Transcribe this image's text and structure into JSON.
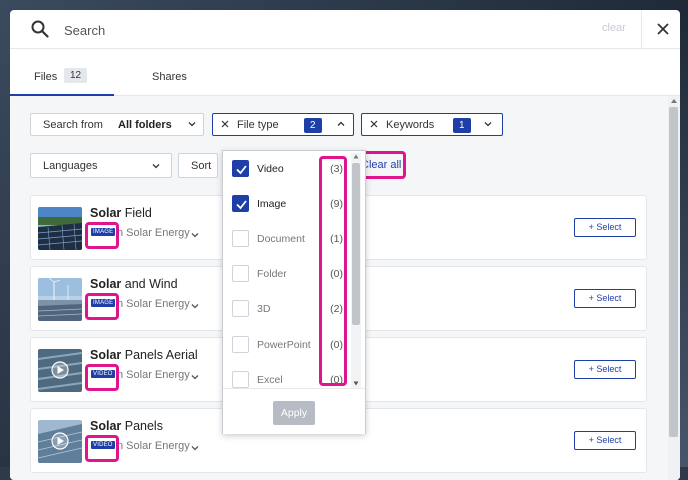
{
  "search": {
    "placeholder": "Search",
    "clear_label": "clear"
  },
  "tabs": [
    {
      "label": "Files",
      "count": "12"
    },
    {
      "label": "Shares"
    }
  ],
  "filters": {
    "search_from": {
      "label": "Search from",
      "value": "All folders"
    },
    "file_type": {
      "label": "File type",
      "count": "2"
    },
    "keywords": {
      "label": "Keywords",
      "count": "1"
    },
    "languages": {
      "label": "Languages"
    },
    "sort": {
      "label": "Sort"
    },
    "clear_all": "Clear all"
  },
  "file_type_options": [
    {
      "label": "Video",
      "count": "(3)",
      "checked": true
    },
    {
      "label": "Image",
      "count": "(9)",
      "checked": true
    },
    {
      "label": "Document",
      "count": "(1)",
      "checked": false
    },
    {
      "label": "Folder",
      "count": "(0)",
      "checked": false
    },
    {
      "label": "3D",
      "count": "(2)",
      "checked": false
    },
    {
      "label": "PowerPoint",
      "count": "(0)",
      "checked": false
    },
    {
      "label": "Excel",
      "count": "(0)",
      "checked": false
    }
  ],
  "apply_label": "Apply",
  "results": [
    {
      "title_bold": "Solar",
      "title_rest": " Field",
      "type": "IMAGE",
      "path": "n Solar Energy",
      "select": "+ Select"
    },
    {
      "title_bold": "Solar",
      "title_rest": " and Wind",
      "type": "IMAGE",
      "path": "n Solar Energy",
      "select": "+ Select"
    },
    {
      "title_bold": "Solar",
      "title_rest": " Panels Aerial",
      "type": "VIDEO",
      "path": "n Solar Energy",
      "select": "+ Select"
    },
    {
      "title_bold": "Solar",
      "title_rest": " Panels",
      "type": "VIDEO",
      "path": "n Solar Energy",
      "select": "+ Select"
    }
  ],
  "colors": {
    "accent": "#1f3fa8",
    "highlight": "#e0158e",
    "muted": "#b7bcc4"
  }
}
